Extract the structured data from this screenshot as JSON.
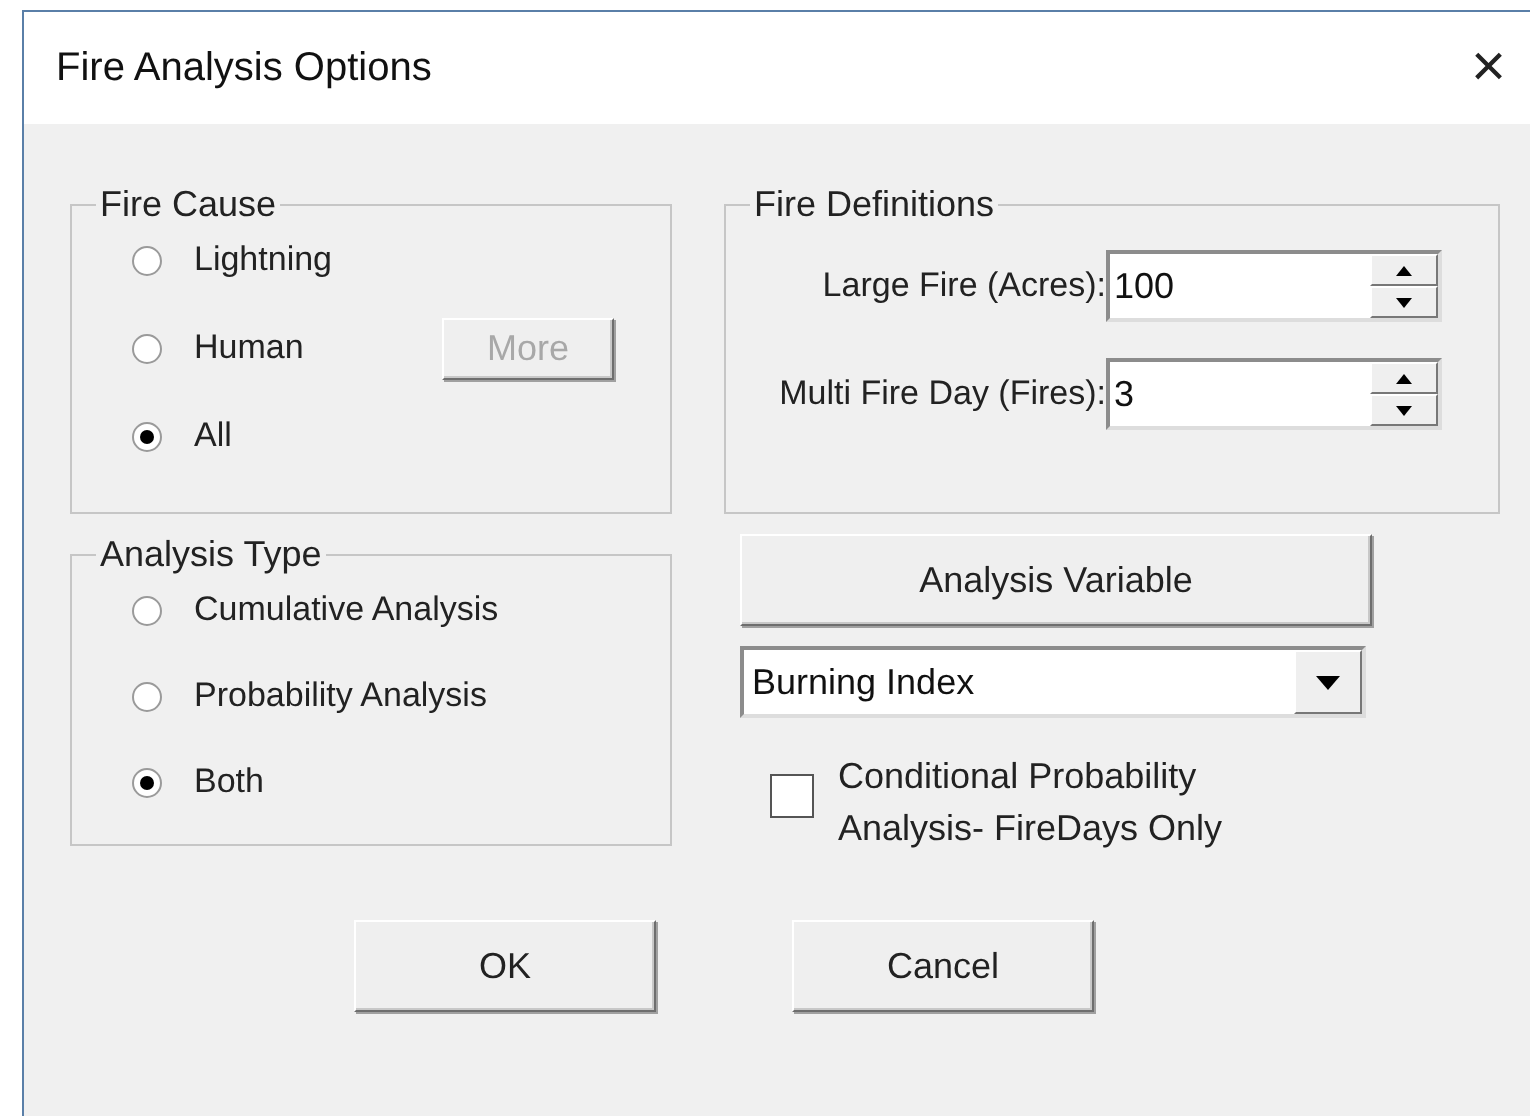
{
  "window": {
    "title": "Fire Analysis Options",
    "close": "×"
  },
  "fire_cause": {
    "title": "Fire Cause",
    "options": [
      {
        "label": "Lightning",
        "selected": false
      },
      {
        "label": "Human",
        "selected": false
      },
      {
        "label": "All",
        "selected": true
      }
    ],
    "more_button": {
      "label": "More",
      "disabled": true
    }
  },
  "fire_definitions": {
    "title": "Fire Definitions",
    "fields": [
      {
        "label": "Large Fire (Acres):",
        "value": "100"
      },
      {
        "label": "Multi Fire Day (Fires):",
        "value": "3"
      }
    ]
  },
  "analysis_type": {
    "title": "Analysis Type",
    "options": [
      {
        "label": "Cumulative Analysis",
        "selected": false
      },
      {
        "label": "Probability Analysis",
        "selected": false
      },
      {
        "label": "Both",
        "selected": true
      }
    ]
  },
  "analysis_variable_button": "Analysis Variable",
  "variable_select": {
    "value": "Burning Index"
  },
  "conditional_checkbox": {
    "label": "Conditional Probability Analysis- FireDays Only",
    "checked": false
  },
  "buttons": [
    "OK",
    "Cancel"
  ]
}
